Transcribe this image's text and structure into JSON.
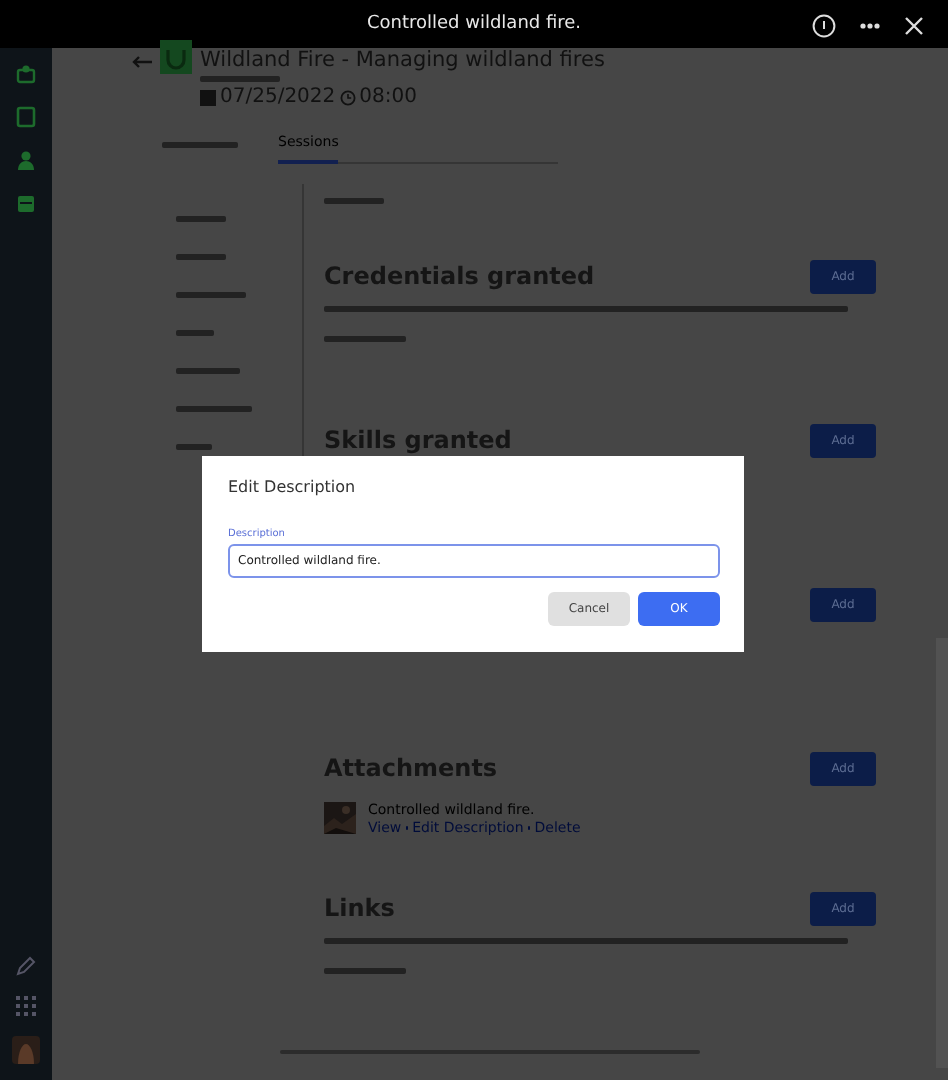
{
  "top_bar": {
    "title": "Controlled wildland fire."
  },
  "course": {
    "title": "Wildland Fire - Managing wildland fires",
    "date": "07/25/2022",
    "time": "08:00"
  },
  "tabs": [
    {
      "label": "Sessions",
      "selected": true
    }
  ],
  "sections": [
    {
      "title": "Credentials granted",
      "button": "Add"
    },
    {
      "title": "Skills granted",
      "button": "Add"
    },
    {
      "button": "Add"
    },
    {
      "title": "Attachments",
      "button": "Add",
      "attachments": [
        {
          "name": "Controlled wildland fire.",
          "actions": [
            "View",
            "Edit Description",
            "Delete"
          ]
        }
      ]
    },
    {
      "title": "Links",
      "button": "Add"
    }
  ],
  "dialog": {
    "title": "Edit Description",
    "field_label": "Description",
    "value": "Controlled wildland fire.",
    "buttons": [
      {
        "label": "Cancel",
        "kind": "secondary"
      },
      {
        "label": "OK",
        "kind": "primary"
      }
    ]
  }
}
